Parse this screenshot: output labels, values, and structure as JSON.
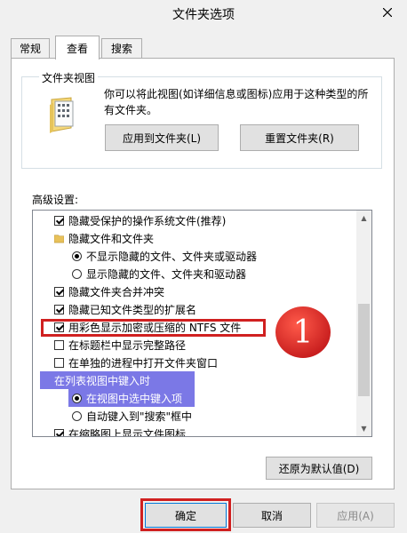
{
  "window": {
    "title": "文件夹选项"
  },
  "tabs": [
    {
      "label": "常规"
    },
    {
      "label": "查看"
    },
    {
      "label": "搜索"
    }
  ],
  "folder_views": {
    "label": "文件夹视图",
    "description": "你可以将此视图(如详细信息或图标)应用于这种类型的所有文件夹。",
    "apply_button": "应用到文件夹(L)",
    "reset_button": "重置文件夹(R)"
  },
  "advanced": {
    "label": "高级设置:",
    "items": [
      {
        "label": "隐藏受保护的操作系统文件(推荐)",
        "type": "checkbox",
        "checked": true
      },
      {
        "label": "隐藏文件和文件夹",
        "type": "folder"
      },
      {
        "label": "不显示隐藏的文件、文件夹或驱动器",
        "type": "radio",
        "checked": true
      },
      {
        "label": "显示隐藏的文件、文件夹和驱动器",
        "type": "radio",
        "checked": false
      },
      {
        "label": "隐藏文件夹合并冲突",
        "type": "checkbox",
        "checked": true
      },
      {
        "label": "隐藏已知文件类型的扩展名",
        "type": "checkbox",
        "checked": true
      },
      {
        "label": "用彩色显示加密或压缩的 NTFS 文件",
        "type": "checkbox",
        "checked": true
      },
      {
        "label": "在标题栏中显示完整路径",
        "type": "checkbox",
        "checked": false
      },
      {
        "label": "在单独的进程中打开文件夹窗口",
        "type": "checkbox",
        "checked": false
      },
      {
        "label": "在列表视图中键入时",
        "type": "folder"
      },
      {
        "label": "在视图中选中键入项",
        "type": "radio",
        "checked": true
      },
      {
        "label": "自动键入到\"搜索\"框中",
        "type": "radio",
        "checked": false
      },
      {
        "label": "在缩略图上显示文件图标",
        "type": "checkbox",
        "checked": true
      }
    ],
    "restore_button": "还原为默认值(D)"
  },
  "footer": {
    "ok_button": "确定",
    "cancel_button": "取消",
    "apply_button": "应用(A)"
  },
  "annotation": {
    "number": "1"
  },
  "colors": {
    "annotation_red": "#d02020",
    "selection_blue": "#7b78e6"
  }
}
